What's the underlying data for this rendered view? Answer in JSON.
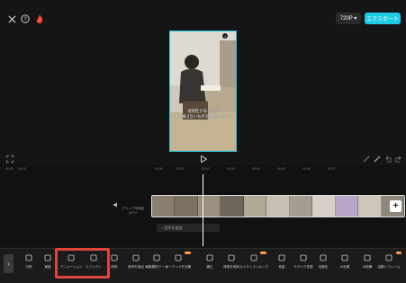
{
  "header": {
    "resolution_label": "720P ▾",
    "export_label": "エクスポート"
  },
  "preview": {
    "subtitle": "透明性があるから\n違う線ばないものを確認して見ます"
  },
  "timeline": {
    "ruler_ticks": [
      "00:00",
      "00:15",
      "00:00",
      "00:01",
      "00:02",
      "00:03",
      "00:04",
      "00:05",
      "00:06",
      "00:07"
    ],
    "cover_label": "クリップを設定\nカバー",
    "add_audio_label": "+ 音声を追加"
  },
  "toolbar": {
    "tools": [
      {
        "label": "分割",
        "icon": "split-icon"
      },
      {
        "label": "速度",
        "icon": "speed-icon"
      },
      {
        "label": "アニメーション",
        "icon": "animation-icon"
      },
      {
        "label": "エフェクト",
        "icon": "effect-icon"
      },
      {
        "label": "削除",
        "icon": "delete-icon"
      },
      {
        "label": "音声を抽出",
        "icon": "extract-audio-icon"
      },
      {
        "label": "編集翻訳ツール",
        "icon": "translate-icon"
      },
      {
        "label": "オーディオを分離",
        "icon": "separate-audio-icon",
        "badge": "New"
      },
      {
        "label": "補正",
        "icon": "adjust-icon"
      },
      {
        "label": "背景を削除",
        "icon": "remove-bg-icon"
      },
      {
        "label": "カメラトラッキング",
        "icon": "camera-tracking-icon",
        "badge": "New"
      },
      {
        "label": "音量",
        "icon": "volume-icon"
      },
      {
        "label": "モザイク変更",
        "icon": "mosaic-icon"
      },
      {
        "label": "自動化",
        "icon": "crop-icon"
      },
      {
        "label": "AI効果",
        "icon": "ai-effect-icon"
      },
      {
        "label": "AI認識",
        "icon": "ai-recognition-icon"
      },
      {
        "label": "自動リフレーム",
        "icon": "reframe-icon",
        "badge": "Pro"
      }
    ]
  },
  "colors": {
    "accent": "#1ccbe6",
    "highlight": "#e0443e",
    "badge": "#ff7a1a"
  }
}
